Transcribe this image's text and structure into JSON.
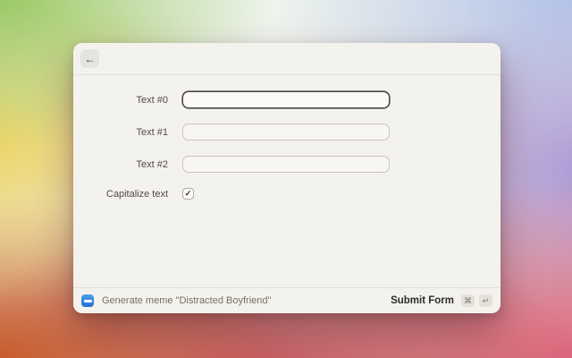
{
  "window": {
    "header": {
      "back_button_glyph": "←"
    },
    "form": {
      "fields": [
        {
          "label": "Text #0",
          "value": "",
          "focused": true
        },
        {
          "label": "Text #1",
          "value": "",
          "focused": false
        },
        {
          "label": "Text #2",
          "value": "",
          "focused": false
        }
      ],
      "checkbox": {
        "label": "Capitalize text",
        "checked": true,
        "check_glyph": "✓"
      }
    },
    "footer": {
      "app_icon_name": "imgflip-meme-icon",
      "action_text": "Generate meme \"Distracted Boyfriend\"",
      "submit_label": "Submit Form",
      "shortcuts": [
        "⌘",
        "↵"
      ]
    }
  },
  "colors": {
    "window_bg": "#f4f2ed",
    "focus_border": "#4a4843",
    "app_icon_blue": "#2f89e0",
    "bg_green": "#97c75f",
    "bg_yellow": "#ecd45e",
    "bg_orange": "#c75a28",
    "bg_red": "#c54a56",
    "bg_pink": "#dd5f78",
    "bg_purple": "#a792d4",
    "bg_blue": "#b1c0e7"
  }
}
